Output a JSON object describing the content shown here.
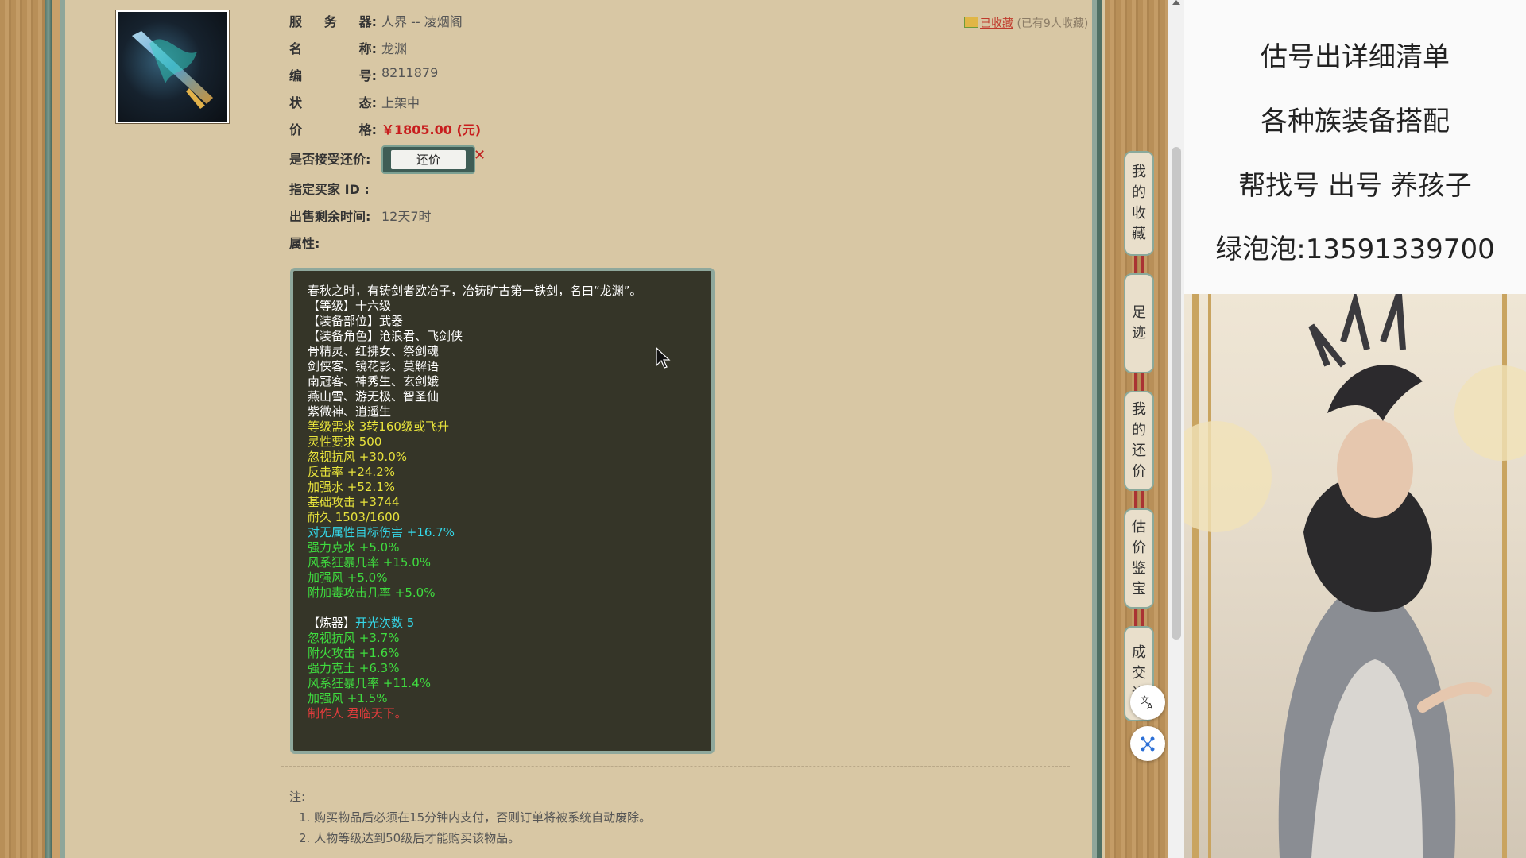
{
  "item": {
    "server_label": "服 务 器:",
    "server_value": "人界 -- 凌烟阁",
    "name_label": "名 称:",
    "name_value": "龙渊",
    "id_label": "编 号:",
    "id_value": "8211879",
    "status_label": "状 态:",
    "status_value": "上架中",
    "price_label": "价 格:",
    "price_value": "￥1805.00 (元)",
    "counter_label": "是否接受还价:",
    "counter_button": "还价",
    "buyer_label": "指定买家 ID :",
    "time_label": "出售剩余时间:",
    "time_value": "12天7时",
    "attr_label": "属性:"
  },
  "favorite": {
    "link": "已收藏",
    "count": "(已有9人收藏)"
  },
  "attributes": [
    {
      "text": "春秋之时，有铸剑者欧冶子，冶铸旷古第一铁剑，名曰“龙渊”。",
      "color": "white"
    },
    {
      "text": "【等级】十六级",
      "color": "white"
    },
    {
      "text": "【装备部位】武器",
      "color": "white"
    },
    {
      "text": "【装备角色】沧浪君、飞剑侠",
      "color": "white"
    },
    {
      "text": "骨精灵、红拂女、祭剑魂",
      "color": "white"
    },
    {
      "text": "剑侠客、镜花影、莫解语",
      "color": "white"
    },
    {
      "text": "南冠客、神秀生、玄剑娥",
      "color": "white"
    },
    {
      "text": "燕山雪、游无极、智圣仙",
      "color": "white"
    },
    {
      "text": "紫微神、逍遥生",
      "color": "white"
    },
    {
      "text": "等级需求 3转160级或飞升",
      "color": "yellow"
    },
    {
      "text": "灵性要求 500",
      "color": "yellow"
    },
    {
      "text": "忽视抗风 +30.0%",
      "color": "yellow"
    },
    {
      "text": "反击率 +24.2%",
      "color": "yellow"
    },
    {
      "text": "加强水 +52.1%",
      "color": "yellow"
    },
    {
      "text": "基础攻击 +3744",
      "color": "yellow"
    },
    {
      "text": "耐久 1503/1600",
      "color": "yellow"
    },
    {
      "text": "对无属性目标伤害 +16.7%",
      "color": "cyan"
    },
    {
      "text": "强力克水 +5.0%",
      "color": "green"
    },
    {
      "text": "风系狂暴几率 +15.0%",
      "color": "green"
    },
    {
      "text": "加强风 +5.0%",
      "color": "green"
    },
    {
      "text": "附加毒攻击几率 +5.0%",
      "color": "green"
    },
    {
      "text": "",
      "color": "blank"
    },
    {
      "text": "【炼器】开光次数 5",
      "color": "cyan",
      "prefix": "【炼器】",
      "prefix_color": "white"
    },
    {
      "text": "忽视抗风 +3.7%",
      "color": "green"
    },
    {
      "text": "附火攻击 +1.6%",
      "color": "green"
    },
    {
      "text": "强力克土 +6.3%",
      "color": "green"
    },
    {
      "text": "风系狂暴几率 +11.4%",
      "color": "green"
    },
    {
      "text": "加强风 +1.5%",
      "color": "green"
    },
    {
      "text": "制作人 君临天下。",
      "color": "red"
    }
  ],
  "notes": {
    "title": "注:",
    "items": [
      "1. 购买物品后必须在15分钟内支付，否则订单将被系统自动废除。",
      "2. 人物等级达到50级后才能购买该物品。"
    ]
  },
  "side_tabs": [
    "我的收藏",
    "足迹",
    "我的还价",
    "估价鉴宝",
    "成交询"
  ],
  "promo": {
    "lines": [
      "估号出详细清单",
      "各种族装备搭配",
      "帮找号 出号 养孩子",
      "绿泡泡:13591339700"
    ]
  }
}
